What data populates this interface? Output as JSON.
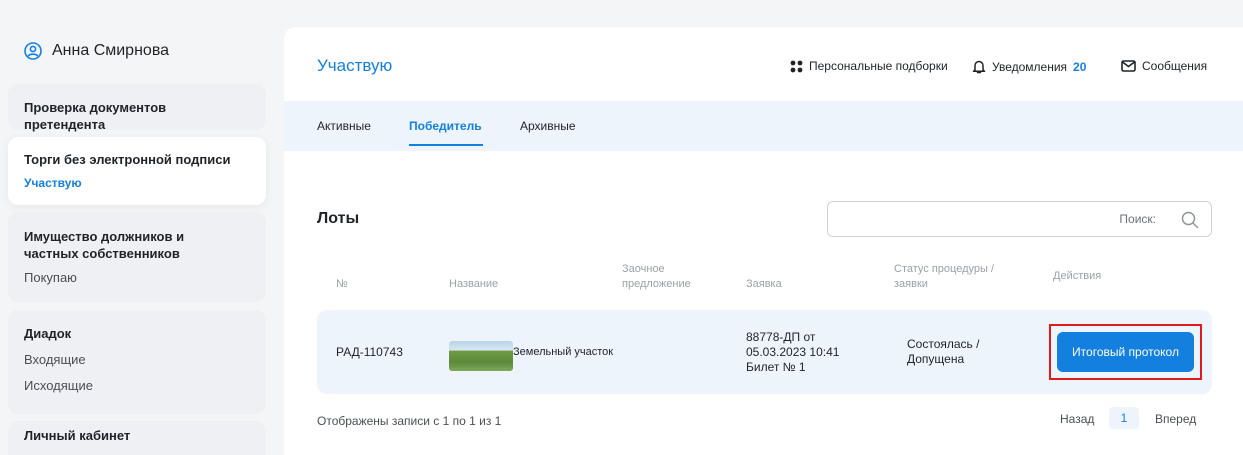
{
  "user": {
    "name": "Анна Смирнова",
    "icon": "user-circle-icon"
  },
  "sidebar": {
    "cards": [
      {
        "title": "Проверка документов претендента",
        "items": []
      },
      {
        "title": "Торги без электронной подписи",
        "items": [
          "Участвую"
        ]
      },
      {
        "title": "Имущество должников и частных собственников",
        "items": [
          "Покупаю"
        ]
      },
      {
        "title": "Диадок",
        "items": [
          "Входящие",
          "Исходящие"
        ]
      },
      {
        "title": "Личный кабинет",
        "items": []
      }
    ]
  },
  "header": {
    "title": "Участвую",
    "personal_label": "Персональные подборки",
    "notifications_label": "Уведомления",
    "notifications_count": "20",
    "messages_label": "Сообщения"
  },
  "tabs": [
    "Активные",
    "Победитель",
    "Архивные"
  ],
  "active_tab": "Победитель",
  "lots": {
    "title": "Лоты",
    "search_placeholder": "Поиск:",
    "columns": [
      "№",
      "Название",
      "Заочное предложение",
      "Заявка",
      "Статус процедуры / заявки",
      "Действия"
    ],
    "rows": [
      {
        "number": "РАД-110743",
        "name": "Земельный участок",
        "application_line1": "88778-ДП от",
        "application_line2": "05.03.2023 10:41",
        "application_line3": "Билет № 1",
        "status_line1": "Состоялась /",
        "status_line2": "Допущена",
        "action_label": "Итоговый протокол"
      }
    ]
  },
  "pagination": {
    "summary": "Отображены записи с 1 по 1 из 1",
    "prev_label": "Назад",
    "current_page": "1",
    "next_label": "Вперед"
  },
  "colors": {
    "accent": "#1380e0",
    "highlight": "#e01b1b",
    "row_bg": "#eef4fb"
  }
}
